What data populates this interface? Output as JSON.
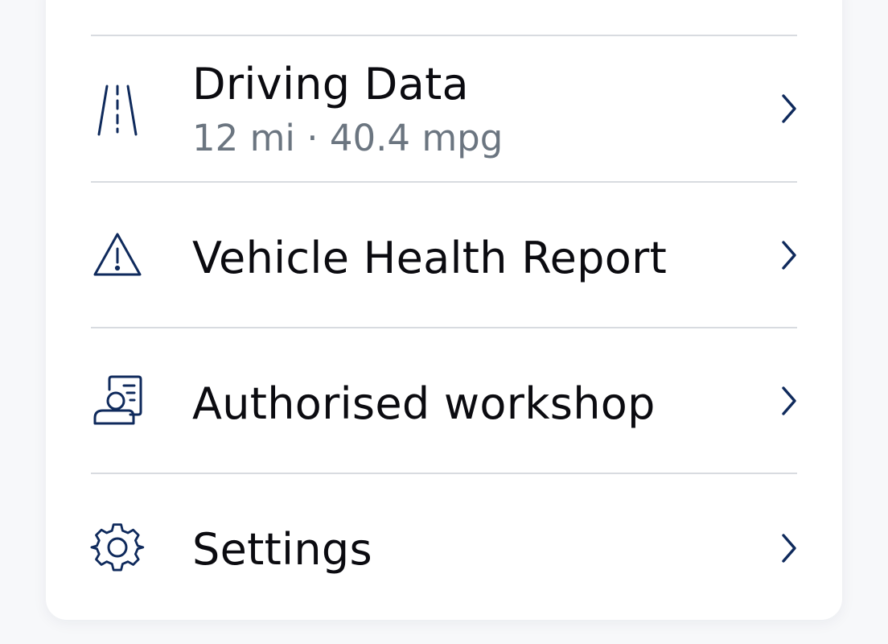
{
  "colors": {
    "background": "#f7f8fa",
    "card": "#ffffff",
    "icon": "#0f2a5c",
    "title": "#0b0b10",
    "subtitle": "#6b7580",
    "divider": "#d8dbe0"
  },
  "menu": {
    "items": [
      {
        "icon": "road-icon",
        "title": "Driving Data",
        "subtitle": "12 mi · 40.4 mpg"
      },
      {
        "icon": "warning-triangle-icon",
        "title": "Vehicle Health Report"
      },
      {
        "icon": "workshop-contact-icon",
        "title": "Authorised workshop"
      },
      {
        "icon": "gear-icon",
        "title": "Settings"
      }
    ]
  }
}
